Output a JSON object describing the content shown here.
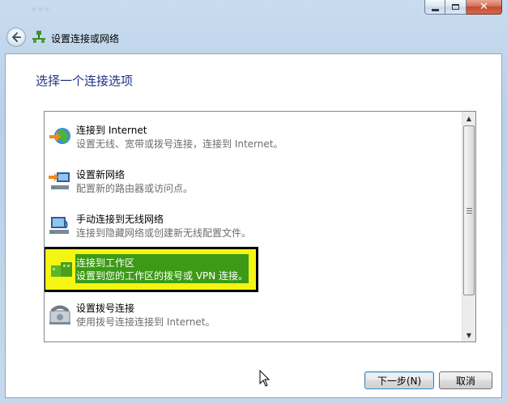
{
  "window": {
    "title": "设置连接或网络",
    "buttons": {
      "minimize_icon": "minimize-icon",
      "maximize_icon": "maximize-icon",
      "close_icon": "close-icon"
    }
  },
  "navigation": {
    "back_icon": "back-arrow-icon"
  },
  "content": {
    "heading": "选择一个连接选项",
    "options": [
      {
        "title": "连接到 Internet",
        "description": "设置无线、宽带或拨号连接，连接到 Internet。",
        "icon": "globe-internet-icon",
        "selected": false
      },
      {
        "title": "设置新网络",
        "description": "配置新的路由器或访问点。",
        "icon": "new-network-icon",
        "selected": false
      },
      {
        "title": "手动连接到无线网络",
        "description": "连接到隐藏网络或创建新无线配置文件。",
        "icon": "wireless-network-icon",
        "selected": false
      },
      {
        "title": "连接到工作区",
        "description": "设置到您的工作区的拨号或 VPN 连接。",
        "icon": "workplace-vpn-icon",
        "selected": true
      },
      {
        "title": "设置拨号连接",
        "description": "使用拨号连接连接到 Internet。",
        "icon": "dialup-phone-icon",
        "selected": false
      }
    ]
  },
  "footer": {
    "next_label": "下一步(N)",
    "cancel_label": "取消"
  },
  "colors": {
    "heading": "#1e3287",
    "selection_highlight": "#3c9a16",
    "annotation_box": "#f5f513"
  }
}
